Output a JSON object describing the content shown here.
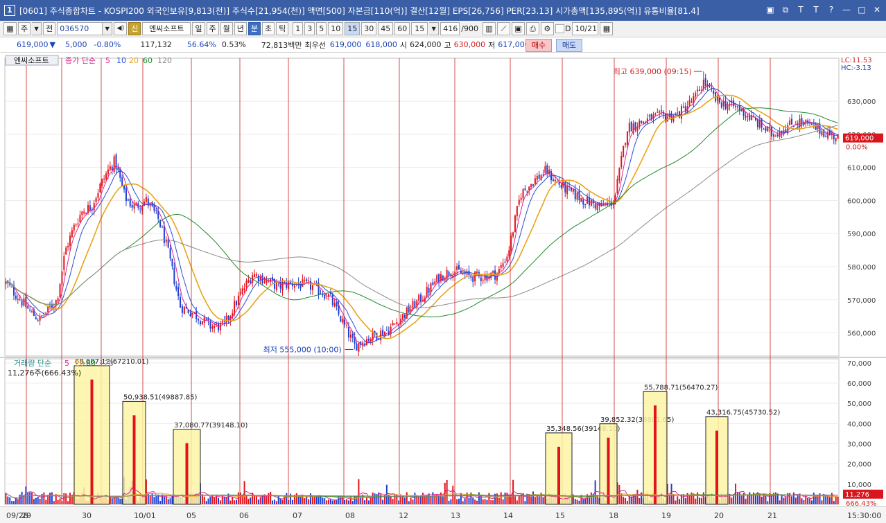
{
  "window": {
    "number": "1",
    "title": "[0601] 주식종합차트 - KOSPI200 외국인보유[9,813(천)] 주식수[21,954(천)] 액면[500] 자본금[110(억)] 결산[12월] EPS[26,756] PER[23.13] 시가총액[135,895(억)] 유통비율[81.4]",
    "controls": [
      "▣",
      "⧉",
      "T",
      "T",
      "?",
      "—",
      "□",
      "✕"
    ]
  },
  "toolbar": {
    "layout_icon": "▦",
    "period_label": "주",
    "prev_label": "전",
    "code_value": "036570",
    "sound_icon": "◀)",
    "new_badge": "신",
    "stock_name": "엔씨소프트",
    "period_tabs": [
      "일",
      "주",
      "월",
      "년",
      "분",
      "초",
      "틱"
    ],
    "active_tab": "분",
    "interval_buttons": [
      "1",
      "3",
      "5",
      "10",
      "15",
      "30",
      "45",
      "60"
    ],
    "active_interval": "15",
    "interval_select": "15",
    "count_value": "416",
    "count_total": "/900",
    "checkbox_label": "D",
    "date_value": "10/21"
  },
  "infobar": {
    "price": "619,000",
    "change_arrow": "▼",
    "change": "5,000",
    "change_pct": "-0.80%",
    "volume": "117,132",
    "vol_ratio": "56.64%",
    "turnover": "0.53%",
    "amount": "72,813백만",
    "best_label": "최우선",
    "best_ask": "619,000",
    "best_bid": "618,000",
    "open_label": "시",
    "open": "624,000",
    "high_label": "고",
    "high": "630,000",
    "low_label": "저",
    "low": "617,000",
    "buy_label": "매수",
    "sell_label": "매도"
  },
  "chart_data": {
    "type": "candlestick+volume",
    "stock": "엔씨소프트",
    "legend": {
      "price_name": "종가 단순",
      "ma_periods": [
        "5",
        "10",
        "20",
        "60",
        "120"
      ],
      "ma_colors": [
        "#e0218a",
        "#2a4fd0",
        "#e8a318",
        "#1d8a2b",
        "#8a8a8a"
      ],
      "volume_name": "거래량 단순",
      "vol_ma_periods": [
        "5",
        "20",
        "60",
        "120"
      ]
    },
    "price_axis": {
      "ticks": [
        630000,
        620000,
        610000,
        600000,
        590000,
        580000,
        570000,
        560000
      ],
      "tick_labels": [
        "630,000",
        "620,000",
        "610,000",
        "600,000",
        "590,000",
        "580,000",
        "570,000",
        "560,000"
      ],
      "range": [
        553000,
        643000
      ]
    },
    "volume_axis": {
      "ticks": [
        70000,
        60000,
        50000,
        40000,
        30000,
        20000,
        10000
      ],
      "tick_labels": [
        "70,000",
        "60,000",
        "50,000",
        "40,000",
        "30,000",
        "20,000",
        "10,000"
      ],
      "range": [
        0,
        72000
      ]
    },
    "x_labels": [
      "09/28",
      "29",
      "30",
      "10/01",
      "05",
      "06",
      "07",
      "08",
      "12",
      "13",
      "14",
      "15",
      "18",
      "19",
      "20",
      "21"
    ],
    "time_label": "15:30:00",
    "lc": "LC:11.53",
    "hc": "HC:-3.13",
    "current_price": "619,000",
    "current_pct": "0.00%",
    "current_volume": "11,276",
    "current_volume_pct": "666.43%",
    "volume_header": "11,276주(666.43%)",
    "high_note": "최고 639,000 (09:15)",
    "low_note": "최저 555,000 (10:00)",
    "volume_highlights": [
      {
        "label": "68,607.12(67210.01)",
        "value": 68607
      },
      {
        "label": "50,938.51(49887.85)",
        "value": 50938
      },
      {
        "label": "37,080.77(39148.10)",
        "value": 37080
      },
      {
        "label": "35,348.56(39148.10)",
        "value": 35348
      },
      {
        "label": "39,852.32(38801.65)",
        "value": 39852
      },
      {
        "label": "55,788.71(56470.27)",
        "value": 55788
      },
      {
        "label": "43,316.75(45730.52)",
        "value": 43316
      }
    ]
  }
}
